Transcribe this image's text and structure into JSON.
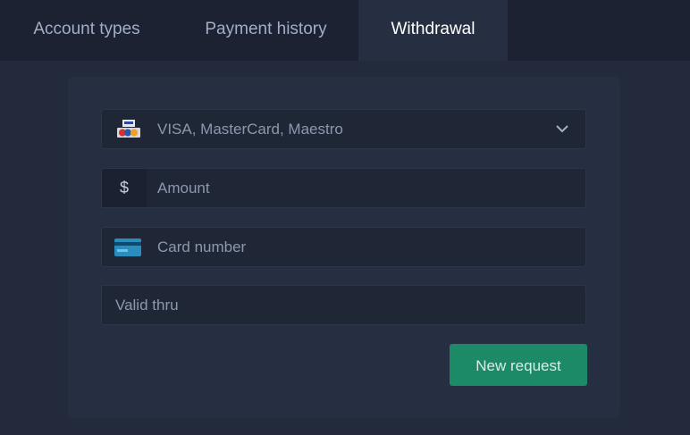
{
  "tabs": [
    {
      "label": "Account types"
    },
    {
      "label": "Payment history"
    },
    {
      "label": "Withdrawal",
      "active": true
    }
  ],
  "form": {
    "method": {
      "value": "VISA, MasterCard, Maestro",
      "icon": "payment-cards-icon"
    },
    "amount": {
      "placeholder": "Amount",
      "currency_symbol": "$"
    },
    "card_number": {
      "placeholder": "Card number",
      "icon": "credit-card-icon"
    },
    "valid_thru": {
      "placeholder": "Valid thru"
    },
    "submit_label": "New request"
  },
  "colors": {
    "background": "#222a3b",
    "tab_bar": "#1c2232",
    "active_tab": "#262f42",
    "button": "#1c8a66"
  }
}
